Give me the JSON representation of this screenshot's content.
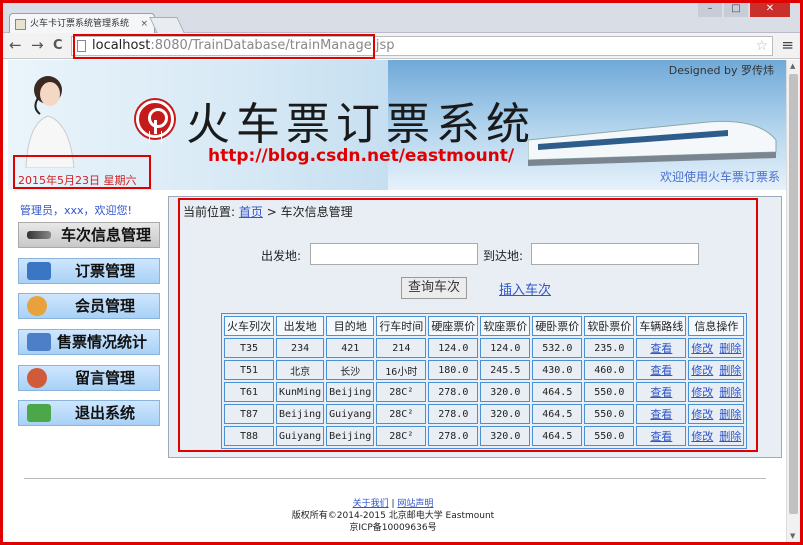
{
  "browser": {
    "tab_title": "火车卡订票系统管理系统",
    "tab_close": "×",
    "url_host": "localhost",
    "url_path": ":8080/TrainDatabase/trainManage.jsp",
    "back": "←",
    "forward": "→",
    "reload": "C",
    "menu": "≡",
    "star": "☆",
    "win_min": "–",
    "win_max": "□",
    "win_close": "✕"
  },
  "banner": {
    "title": "火车票订票系统",
    "url": "http://blog.csdn.net/eastmount/",
    "designed_by": "Designed by 罗传炜",
    "welcome": "欢迎使用火车票订票系",
    "date": "2015年5月23日 星期六"
  },
  "sidebar": {
    "admin_text": "管理员，xxx，欢迎您!",
    "items": [
      {
        "label": "车次信息管理",
        "icon": "train-icon"
      },
      {
        "label": "订票管理",
        "icon": "ticket-icon"
      },
      {
        "label": "会员管理",
        "icon": "member-icon"
      },
      {
        "label": "售票情况统计",
        "icon": "stats-icon"
      },
      {
        "label": "留言管理",
        "icon": "message-icon"
      },
      {
        "label": "退出系统",
        "icon": "logout-icon"
      }
    ]
  },
  "main": {
    "breadcrumb_prefix": "当前位置:",
    "breadcrumb_home": "首页",
    "breadcrumb_sep": " > ",
    "breadcrumb_current": "车次信息管理",
    "from_label": "出发地:",
    "to_label": "到达地:",
    "from_value": "",
    "to_value": "",
    "query_button": "查询车次",
    "insert_link": "插入车次",
    "table": {
      "headers": [
        "火车列次",
        "出发地",
        "目的地",
        "行车时间",
        "硬座票价",
        "软座票价",
        "硬卧票价",
        "软卧票价",
        "车辆路线",
        "信息操作"
      ],
      "rows": [
        [
          "T35",
          "234",
          "421",
          "214",
          "124.0",
          "124.0",
          "532.0",
          "235.0",
          "查看",
          "修改",
          "删除"
        ],
        [
          "T51",
          "北京",
          "长沙",
          "16小时",
          "180.0",
          "245.5",
          "430.0",
          "460.0",
          "查看",
          "修改",
          "删除"
        ],
        [
          "T61",
          "KunMing",
          "Beijing",
          "28C²",
          "278.0",
          "320.0",
          "464.5",
          "550.0",
          "查看",
          "修改",
          "删除"
        ],
        [
          "T87",
          "Beijing",
          "Guiyang",
          "28C²",
          "278.0",
          "320.0",
          "464.5",
          "550.0",
          "查看",
          "修改",
          "删除"
        ],
        [
          "T88",
          "Guiyang",
          "Beijing",
          "28C²",
          "278.0",
          "320.0",
          "464.5",
          "550.0",
          "查看",
          "修改",
          "删除"
        ]
      ]
    }
  },
  "footer": {
    "about": "关于我们",
    "sep": " | ",
    "statement": "网站声明",
    "copyright": "版权所有©2014-2015 北京邮电大学 Eastmount",
    "icp": "京ICP备10009636号"
  }
}
